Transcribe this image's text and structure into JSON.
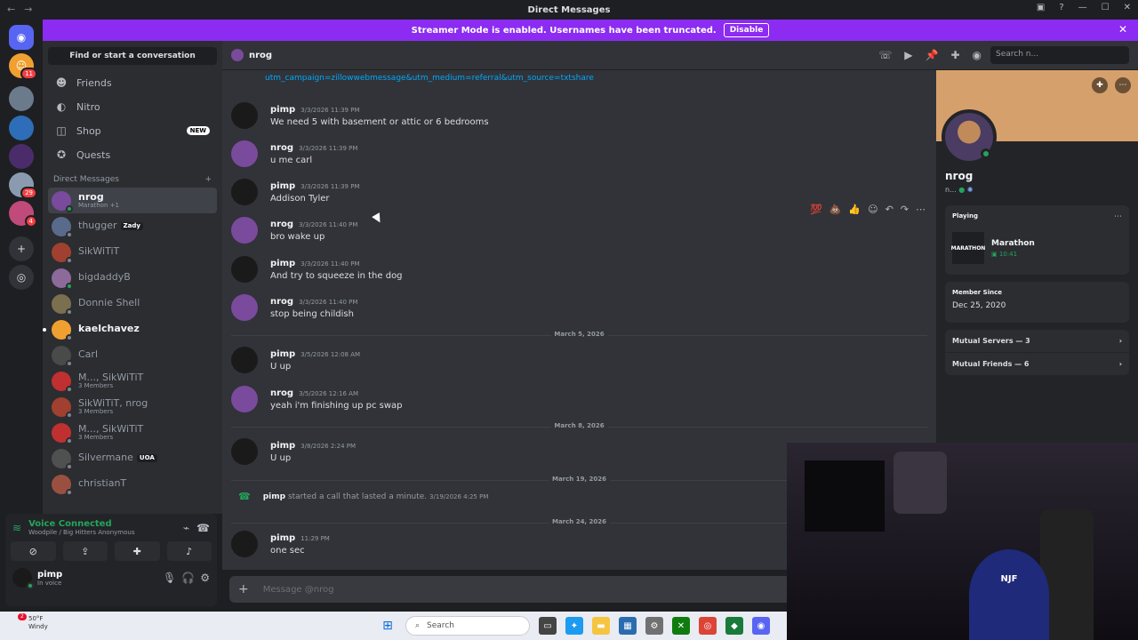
{
  "window": {
    "title": "Direct Messages"
  },
  "banner": {
    "text": "Streamer Mode is enabled. Usernames have been truncated.",
    "button": "Disable"
  },
  "servers": [
    {
      "color": "#5865f2",
      "glyph": "◉",
      "badge": ""
    },
    {
      "color": "#f0a030",
      "glyph": "☺",
      "badge": "11"
    },
    {
      "color": "#6b7b8c",
      "glyph": "",
      "badge": ""
    },
    {
      "color": "#2e6db8",
      "glyph": "",
      "badge": ""
    },
    {
      "color": "#4b2c6b",
      "glyph": "",
      "badge": ""
    },
    {
      "color": "#8a9bb0",
      "glyph": "",
      "badge": "29"
    },
    {
      "color": "#c04a7a",
      "glyph": "",
      "badge": "4"
    }
  ],
  "sidebar": {
    "find": "Find or start a conversation",
    "nav": [
      {
        "label": "Friends",
        "icon": "friends-icon"
      },
      {
        "label": "Nitro",
        "icon": "nitro-icon"
      },
      {
        "label": "Shop",
        "icon": "shop-icon",
        "badge": "NEW"
      },
      {
        "label": "Quests",
        "icon": "quests-icon"
      }
    ],
    "dm_header": "Direct Messages",
    "dms": [
      {
        "name": "nrog",
        "sub": "Marathon +1",
        "color": "#7a4a9c",
        "online": true,
        "active": true,
        "bright": true
      },
      {
        "name": "thugger",
        "tag": "Zady",
        "color": "#5a6a8c",
        "online": false
      },
      {
        "name": "SikWiTiT",
        "color": "#a04030",
        "online": false
      },
      {
        "name": "bigdaddyB",
        "color": "#8c6a9a",
        "online": true
      },
      {
        "name": "Donnie Shell",
        "color": "#7a7050",
        "online": false
      },
      {
        "name": "kaelchavez",
        "color": "#f0a030",
        "online": false,
        "bright": true,
        "unread": true
      },
      {
        "name": "Carl",
        "color": "#4a4a4a",
        "online": false
      },
      {
        "name": "M..., SikWiTiT",
        "sub": "3 Members",
        "color": "#c03030",
        "online": false
      },
      {
        "name": "SikWiTiT, nrog",
        "sub": "3 Members",
        "color": "#a04030",
        "online": false
      },
      {
        "name": "M..., SikWiTiT",
        "sub": "3 Members",
        "color": "#c03030",
        "online": false
      },
      {
        "name": "Silvermane",
        "tag": "UOA",
        "color": "#505050",
        "online": false
      },
      {
        "name": "christianT",
        "color": "#9a5040",
        "online": false
      }
    ],
    "voice": {
      "title": "Voice Connected",
      "channel": "Woodpile / Big Hitters Anonymous"
    },
    "me": {
      "name": "pimp",
      "status": "In voice"
    }
  },
  "chat": {
    "header_name": "nrog",
    "search_placeholder": "Search n...",
    "link": "utm_campaign=zillowwebmessage&utm_medium=referral&utm_source=txtshare",
    "messages": [
      {
        "author": "pimp",
        "time": "3/3/2026 11:39 PM",
        "text": "We need 5 with basement or attic or 6 bedrooms",
        "color": "#1a1a1a"
      },
      {
        "author": "nrog",
        "time": "3/3/2026 11:39 PM",
        "text": "u me carl",
        "color": "#7a4a9c"
      },
      {
        "author": "pimp",
        "time": "3/3/2026 11:39 PM",
        "text": "Addison Tyler",
        "color": "#1a1a1a"
      },
      {
        "author": "nrog",
        "time": "3/3/2026 11:40 PM",
        "text": "bro wake up",
        "color": "#7a4a9c"
      },
      {
        "author": "pimp",
        "time": "3/3/2026 11:40 PM",
        "text": "And try to squeeze in the dog",
        "color": "#1a1a1a"
      },
      {
        "author": "nrog",
        "time": "3/3/2026 11:40 PM",
        "text": "stop being childish",
        "color": "#7a4a9c"
      },
      {
        "author": "pimp",
        "time": "3/5/2026 12:08 AM",
        "text": "U up",
        "color": "#1a1a1a"
      },
      {
        "author": "nrog",
        "time": "3/5/2026 12:16 AM",
        "text": "yeah i'm finishing up pc swap",
        "color": "#7a4a9c"
      },
      {
        "author": "pimp",
        "time": "3/8/2026 2:24 PM",
        "text": "U up",
        "color": "#1a1a1a"
      },
      {
        "author": "pimp",
        "time": "11:29 PM",
        "text": "one sec",
        "color": "#1a1a1a"
      }
    ],
    "dividers": [
      "March 5, 2026",
      "March 8, 2026",
      "March 19, 2026",
      "March 24, 2026"
    ],
    "call": {
      "author": "pimp",
      "text": "started a call that lasted a minute.",
      "time": "3/19/2026 4:25 PM"
    },
    "composer_placeholder": "Message @nrog"
  },
  "profile": {
    "name": "nrog",
    "sub": "n...",
    "playing_label": "Playing",
    "game": "Marathon",
    "game_icon": "MARATHON",
    "game_time": "10:41",
    "member_since_label": "Member Since",
    "member_since": "Dec 25, 2020",
    "mutual_servers": "Mutual Servers — 3",
    "mutual_friends": "Mutual Friends — 6"
  },
  "taskbar": {
    "temp": "50°F",
    "cond": "Windy",
    "weather_badge": "2",
    "search": "Search"
  },
  "webcam": {
    "cap": "NJF"
  }
}
